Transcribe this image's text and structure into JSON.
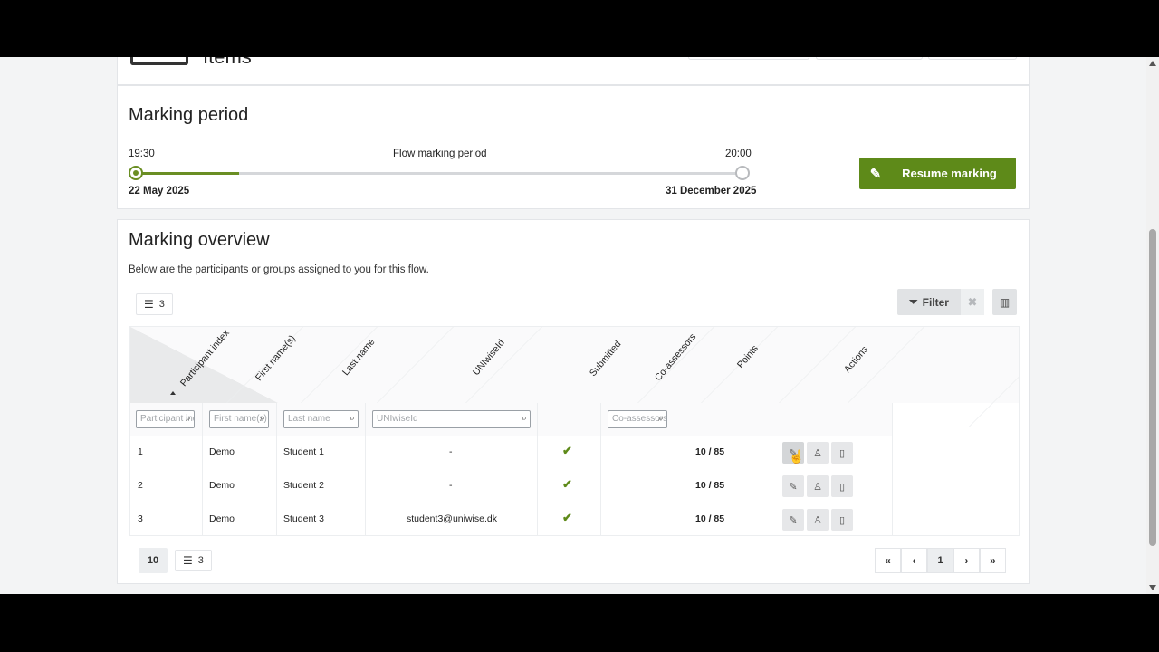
{
  "top_card": {
    "title": "Items"
  },
  "marking_period": {
    "heading": "Marking period",
    "start_time": "19:30",
    "end_time": "20:00",
    "center_label": "Flow marking period",
    "start_date": "22 May 2025",
    "end_date": "31 December 2025",
    "progress_fraction": 0.17,
    "resume_button": "Resume marking",
    "accent_color": "#5e8a19"
  },
  "overview": {
    "heading": "Marking overview",
    "subtitle": "Below are the participants or groups assigned to you for this flow.",
    "count_chip": "3",
    "filter_button": "Filter",
    "columns": [
      "Participant index",
      "First name(s)",
      "Last name",
      "UNIwiseId",
      "Submitted",
      "Co-assessors",
      "Points",
      "Actions"
    ],
    "filter_placeholders": {
      "index": "Participant index",
      "first": "First name(s)",
      "last": "Last name",
      "uniwise": "UNIwiseId",
      "coassessor": "Co-assessors"
    },
    "rows": [
      {
        "index": "1",
        "first": "Demo",
        "last": "Student 1",
        "uniwise": "-",
        "points": "10 / 85"
      },
      {
        "index": "2",
        "first": "Demo",
        "last": "Student 2",
        "uniwise": "-",
        "points": "10 / 85"
      },
      {
        "index": "3",
        "first": "Demo",
        "last": "Student 3",
        "uniwise": "student3@uniwise.dk",
        "points": "10 / 85"
      }
    ],
    "page_size": "10",
    "total_count": "3",
    "current_page": "1"
  }
}
